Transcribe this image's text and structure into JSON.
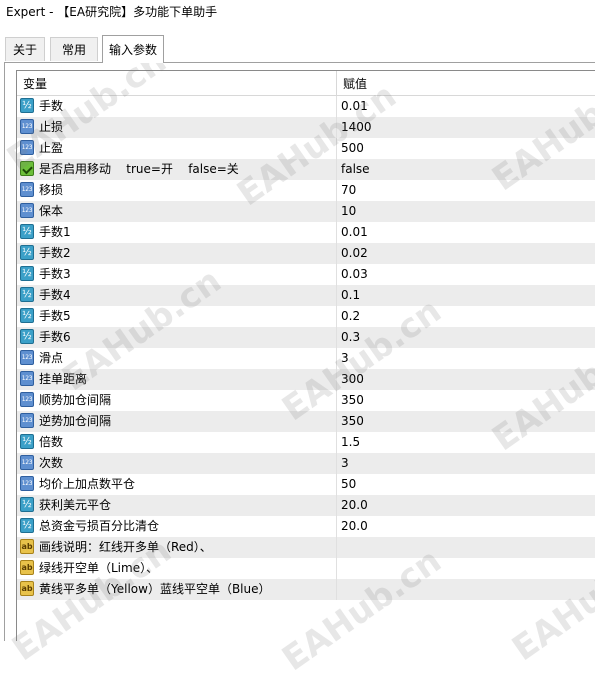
{
  "window": {
    "title": "Expert - 【EA研究院】多功能下单助手"
  },
  "tabs": [
    {
      "label": "关于"
    },
    {
      "label": "常用"
    },
    {
      "label": "输入参数"
    }
  ],
  "grid": {
    "col_variable": "变量",
    "col_value": "赋值",
    "rows": [
      {
        "icon": "double-icon",
        "name": "手数",
        "value": "0.01"
      },
      {
        "icon": "integer-icon",
        "name": "止损",
        "value": "1400"
      },
      {
        "icon": "integer-icon",
        "name": "止盈",
        "value": "500"
      },
      {
        "icon": "bool-icon",
        "name": "是否启用移动    true=开    false=关",
        "value": "false"
      },
      {
        "icon": "integer-icon",
        "name": "移损",
        "value": "70"
      },
      {
        "icon": "integer-icon",
        "name": "保本",
        "value": "10"
      },
      {
        "icon": "double-icon",
        "name": "手数1",
        "value": "0.01"
      },
      {
        "icon": "double-icon",
        "name": "手数2",
        "value": "0.02"
      },
      {
        "icon": "double-icon",
        "name": "手数3",
        "value": "0.03"
      },
      {
        "icon": "double-icon",
        "name": "手数4",
        "value": "0.1"
      },
      {
        "icon": "double-icon",
        "name": "手数5",
        "value": "0.2"
      },
      {
        "icon": "double-icon",
        "name": "手数6",
        "value": "0.3"
      },
      {
        "icon": "integer-icon",
        "name": "滑点",
        "value": "3"
      },
      {
        "icon": "integer-icon",
        "name": "挂单距离",
        "value": "300"
      },
      {
        "icon": "integer-icon",
        "name": "顺势加仓间隔",
        "value": "350"
      },
      {
        "icon": "integer-icon",
        "name": "逆势加仓间隔",
        "value": "350"
      },
      {
        "icon": "double-icon",
        "name": "倍数",
        "value": "1.5"
      },
      {
        "icon": "integer-icon",
        "name": "次数",
        "value": "3"
      },
      {
        "icon": "integer-icon",
        "name": "均价上加点数平仓",
        "value": "50"
      },
      {
        "icon": "double-icon",
        "name": "获利美元平仓",
        "value": "20.0"
      },
      {
        "icon": "double-icon",
        "name": "总资金亏损百分比清仓",
        "value": "20.0"
      },
      {
        "icon": "string-icon",
        "name": "画线说明：红线开多单（Red）、",
        "value": ""
      },
      {
        "icon": "string-icon",
        "name": "绿线开空单（Lime）、",
        "value": ""
      },
      {
        "icon": "string-icon",
        "name": "黄线平多单（Yellow）蓝线平空单（Blue）",
        "value": ""
      }
    ]
  },
  "watermark": {
    "text": "EAHub.cn",
    "color": "#787878"
  }
}
